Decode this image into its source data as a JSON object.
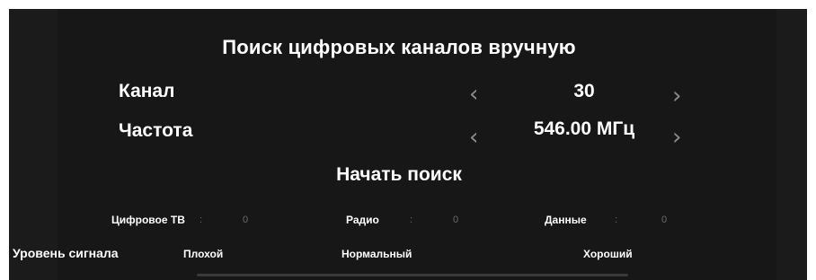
{
  "dialog": {
    "title": "Поиск цифровых каналов вручную",
    "channel": {
      "label": "Канал",
      "value": "30"
    },
    "frequency": {
      "label": "Частота",
      "value": "546.00 МГц"
    },
    "start_button": "Начать поиск"
  },
  "icons": {
    "prev": "chevron-left-icon",
    "next": "chevron-right-icon"
  },
  "stats": [
    {
      "label": "Цифровое ТВ",
      "separator": ":",
      "value": "0"
    },
    {
      "label": "Радио",
      "separator": ":",
      "value": "0"
    },
    {
      "label": "Данные",
      "separator": ":",
      "value": "0"
    }
  ],
  "signal": {
    "label": "Уровень сигнала",
    "levels": [
      "Плохой",
      "Нормальный",
      "Хороший"
    ],
    "level_fraction": 0
  },
  "colors": {
    "background": "#1b1b1b",
    "panel": "#171717",
    "text": "#ffffff",
    "muted": "#6a6a6a",
    "arrow": "#8c8c8c"
  }
}
